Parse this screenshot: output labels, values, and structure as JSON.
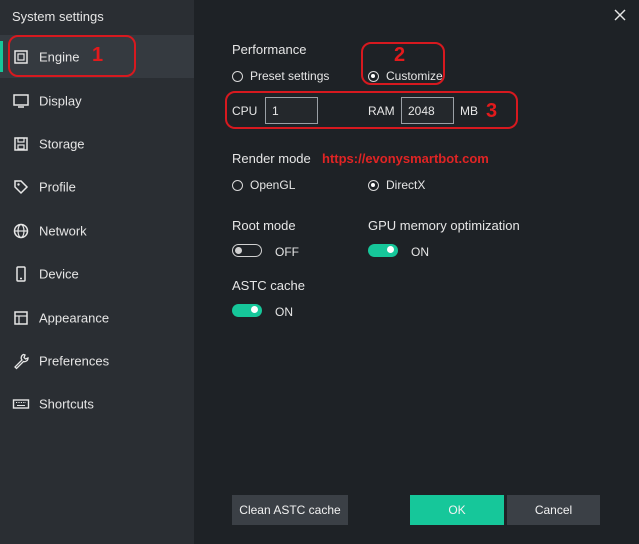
{
  "window": {
    "title": "System settings"
  },
  "sidebar": {
    "items": [
      {
        "label": "Engine",
        "icon": "chip-icon",
        "active": true
      },
      {
        "label": "Display",
        "icon": "monitor-icon"
      },
      {
        "label": "Storage",
        "icon": "save-icon"
      },
      {
        "label": "Profile",
        "icon": "tag-icon"
      },
      {
        "label": "Network",
        "icon": "globe-icon"
      },
      {
        "label": "Device",
        "icon": "phone-icon"
      },
      {
        "label": "Appearance",
        "icon": "window-icon"
      },
      {
        "label": "Preferences",
        "icon": "wrench-icon"
      },
      {
        "label": "Shortcuts",
        "icon": "keyboard-icon"
      }
    ]
  },
  "performance": {
    "title": "Performance",
    "options": [
      "Preset settings",
      "Customize"
    ],
    "selected": "Customize",
    "cpu_label": "CPU",
    "cpu_value": "1",
    "ram_label": "RAM",
    "ram_value": "2048",
    "ram_unit": "MB"
  },
  "render": {
    "title": "Render mode",
    "options": [
      "OpenGL",
      "DirectX"
    ],
    "selected": "DirectX"
  },
  "root_mode": {
    "title": "Root mode",
    "state": "OFF"
  },
  "gpu_opt": {
    "title": "GPU memory optimization",
    "state": "ON"
  },
  "astc": {
    "title": "ASTC cache",
    "state": "ON"
  },
  "buttons": {
    "clean": "Clean ASTC cache",
    "ok": "OK",
    "cancel": "Cancel"
  },
  "annotations": {
    "n1": "1",
    "n2": "2",
    "n3": "3",
    "url": "https://evonysmartbot.com"
  },
  "colors": {
    "accent": "#16c79a",
    "annotation": "#d7191f",
    "sidebar_bg": "#2a2e33",
    "content_bg": "#1e2226"
  }
}
